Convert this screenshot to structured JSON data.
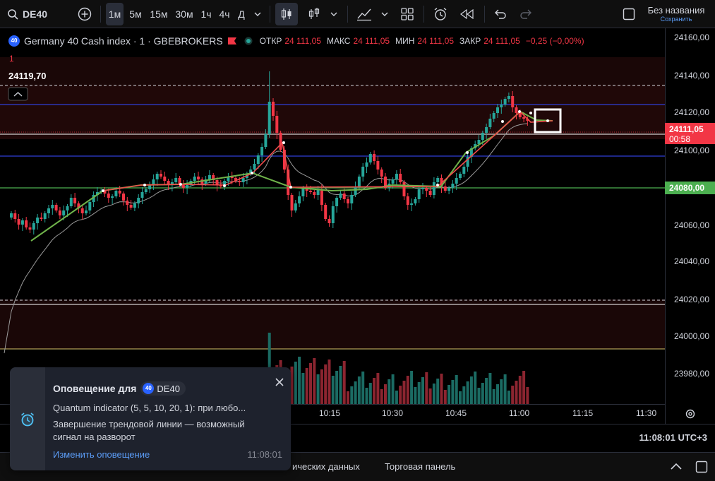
{
  "toolbar": {
    "symbol": "DE40",
    "intervals": [
      "1м",
      "5м",
      "15м",
      "30м",
      "1ч",
      "4ч",
      "Д"
    ],
    "selected_interval": "1м",
    "layout_name": "Без названия",
    "save_status": "Сохранить"
  },
  "legend": {
    "badge": "40",
    "title": "Germany 40 Cash index · 1 · GBEBROKERS",
    "sub_count": "1",
    "open_label": "ОТКР",
    "open_value": "24 111,05",
    "high_label": "МАКС",
    "high_value": "24 111,05",
    "low_label": "МИН",
    "low_value": "24 111,05",
    "close_label": "ЗАКР",
    "close_value": "24 111,05",
    "change": "−0,25 (−0,00%)",
    "line_label": "24119,70"
  },
  "price_axis": {
    "ticks": [
      "24160,00",
      "24140,00",
      "24120,00",
      "24100,00",
      "24080,00",
      "24060,00",
      "24040,00",
      "24020,00",
      "24000,00",
      "23980,00"
    ],
    "current_price": "24111,05",
    "countdown": "00:58",
    "green_level": "24080,00"
  },
  "time_axis": {
    "ticks": [
      "10:15",
      "10:30",
      "10:45",
      "11:00",
      "11:15",
      "11:30"
    ]
  },
  "status_bar": {
    "clock": "11:08:01 UTC+3"
  },
  "panel_bar": {
    "tab_partial": "ических данных",
    "tab_trading": "Торговая панель"
  },
  "alert": {
    "title": "Оповещение для",
    "symbol_badge": "40",
    "symbol": "DE40",
    "line1": "Quantum indicator (5, 5, 10, 20, 1): при любо...",
    "line2": "Завершение трендовой линии — возможный сигнал на разворот",
    "link": "Изменить оповещение",
    "time": "11:08:01"
  },
  "colors": {
    "up": "#26a69a",
    "down": "#f23645",
    "background": "#000000",
    "green_line": "#4caf50",
    "blue_line": "#2f3fd6",
    "yellow_line": "#d4c26a"
  }
}
